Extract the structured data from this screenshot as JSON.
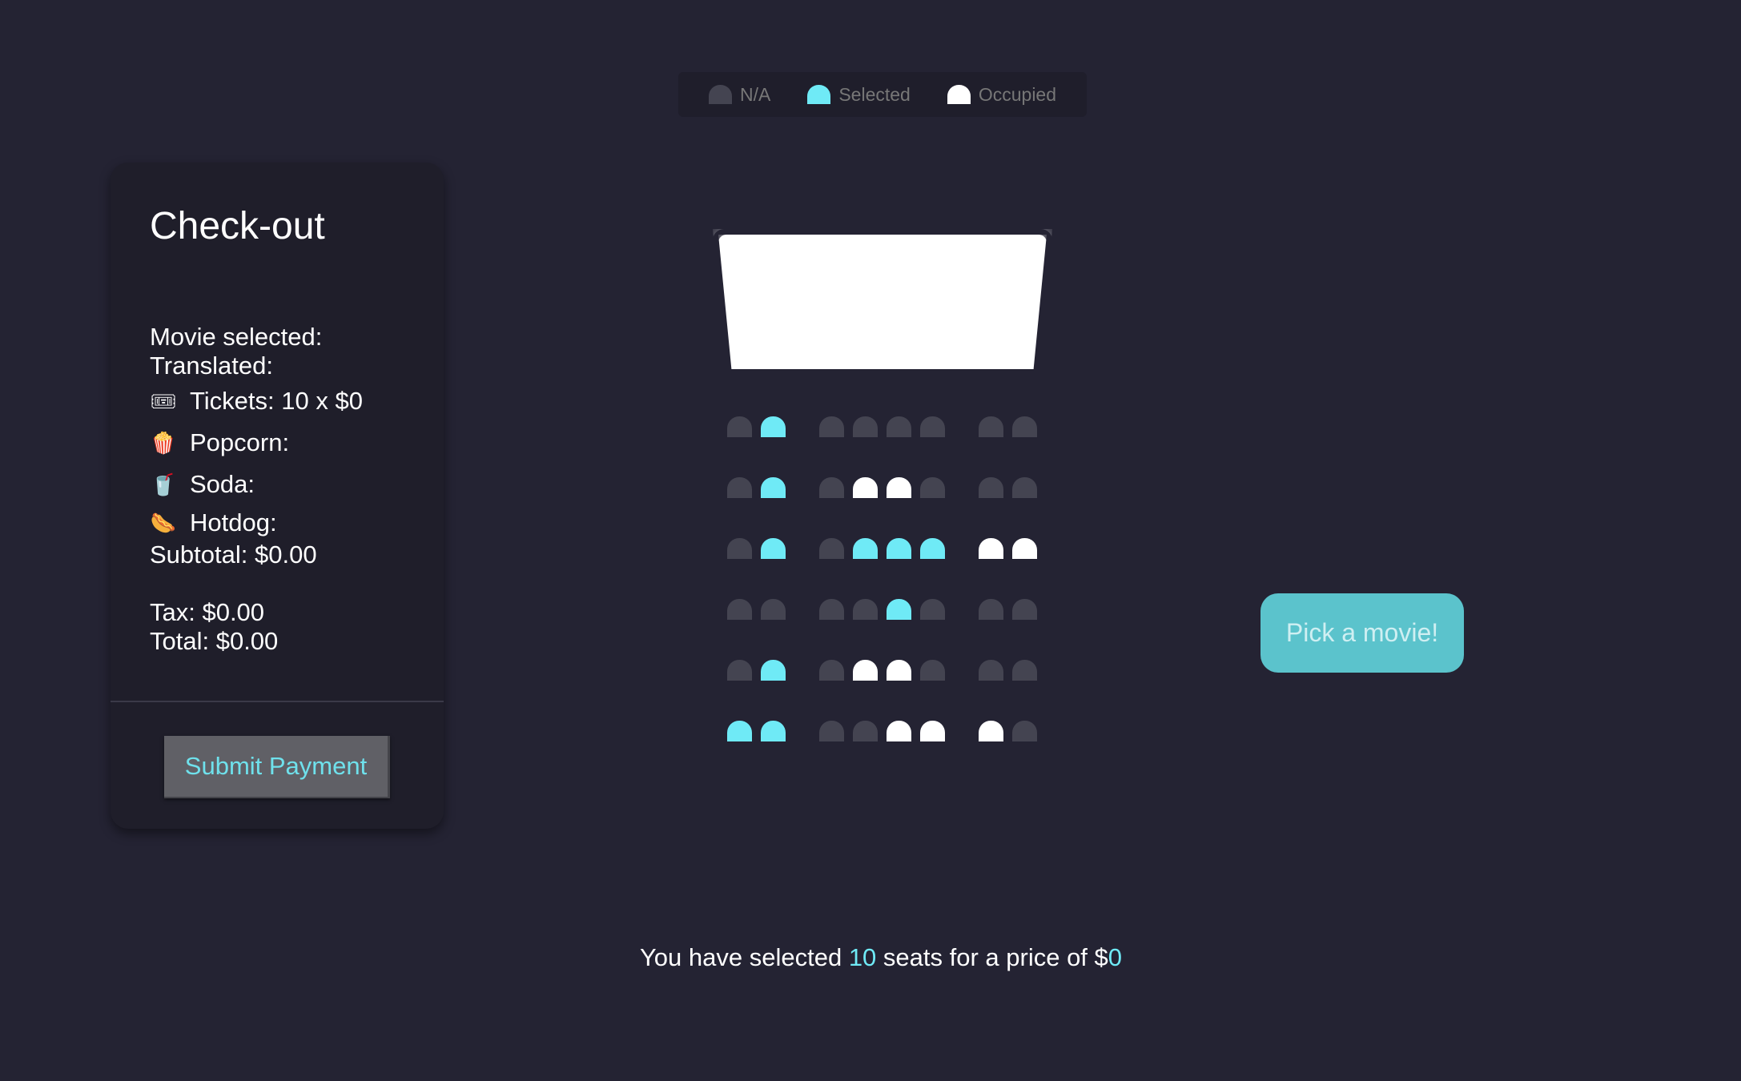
{
  "legend": {
    "items": [
      {
        "label": "N/A",
        "color": "#444451"
      },
      {
        "label": "Selected",
        "color": "#6feaf6"
      },
      {
        "label": "Occupied",
        "color": "#ffffff"
      }
    ]
  },
  "checkout": {
    "title": "Check-out",
    "movie_selected": "Movie selected:",
    "translated": "Translated:",
    "tickets": {
      "icon": "ticket-icon",
      "emoji": "🎟",
      "label": "Tickets: 10 x $0"
    },
    "popcorn": {
      "icon": "popcorn-icon",
      "emoji": "🍿",
      "label": "Popcorn:"
    },
    "soda": {
      "icon": "soda-icon",
      "emoji": "🥤",
      "label": "Soda:"
    },
    "hotdog": {
      "icon": "hotdog-icon",
      "emoji": "🌭",
      "label": "Hotdog:"
    },
    "subtotal": "Subtotal: $0.00",
    "tax": "Tax: $0.00",
    "total": "Total: $0.00",
    "submit_label": "Submit Payment"
  },
  "seats": {
    "rows": [
      [
        "na",
        "selected",
        "na",
        "na",
        "na",
        "na",
        "na",
        "na"
      ],
      [
        "na",
        "selected",
        "na",
        "occupied",
        "occupied",
        "na",
        "na",
        "na"
      ],
      [
        "na",
        "selected",
        "na",
        "selected",
        "selected",
        "selected",
        "occupied",
        "occupied"
      ],
      [
        "na",
        "na",
        "na",
        "na",
        "selected",
        "na",
        "na",
        "na"
      ],
      [
        "na",
        "selected",
        "na",
        "occupied",
        "occupied",
        "na",
        "na",
        "na"
      ],
      [
        "selected",
        "selected",
        "na",
        "na",
        "occupied",
        "occupied",
        "occupied",
        "na"
      ]
    ]
  },
  "pick_movie": {
    "label": "Pick a movie!"
  },
  "summary": {
    "prefix": "You have selected ",
    "count": "10",
    "middle": " seats for a price of $",
    "price": "0"
  }
}
